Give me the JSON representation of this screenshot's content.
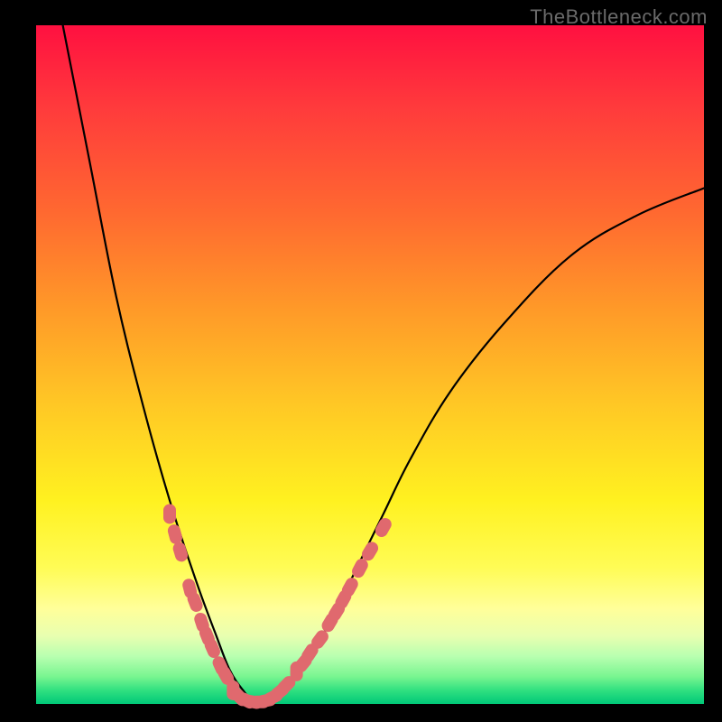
{
  "watermark": "TheBottleneck.com",
  "chart_data": {
    "type": "line",
    "title": "",
    "xlabel": "",
    "ylabel": "",
    "xlim": [
      0,
      100
    ],
    "ylim": [
      0,
      100
    ],
    "grid": false,
    "legend": false,
    "series": [
      {
        "name": "main-curve",
        "color": "#000000",
        "x": [
          4,
          8,
          12,
          16,
          20,
          24,
          27,
          29,
          31,
          33,
          35,
          37,
          40,
          44,
          48,
          52,
          56,
          62,
          70,
          80,
          90,
          100
        ],
        "y": [
          100,
          80,
          60,
          44,
          30,
          18,
          10,
          5,
          2,
          0,
          0,
          2,
          6,
          12,
          20,
          28,
          36,
          46,
          56,
          66,
          72,
          76
        ]
      },
      {
        "name": "overlay-dots-left",
        "color": "#e0696e",
        "x": [
          20.0,
          20.8,
          21.6,
          23.0,
          23.8,
          24.8,
          25.6,
          26.4,
          27.6,
          28.4
        ],
        "y": [
          28.0,
          25.0,
          22.4,
          17.0,
          15.0,
          12.0,
          10.0,
          8.2,
          5.6,
          4.2
        ]
      },
      {
        "name": "overlay-dots-bottom",
        "color": "#e0696e",
        "x": [
          29.5,
          30.5,
          31.5,
          32.5,
          33.5,
          34.5,
          35.5,
          36.5,
          37.5
        ],
        "y": [
          2.0,
          1.0,
          0.5,
          0.3,
          0.3,
          0.5,
          1.0,
          1.8,
          2.8
        ]
      },
      {
        "name": "overlay-dots-right",
        "color": "#e0696e",
        "x": [
          39.0,
          40.0,
          41.0,
          42.5,
          44.0,
          45.0,
          46.0,
          47.0,
          48.5,
          50.0,
          52.0
        ],
        "y": [
          4.8,
          6.0,
          7.5,
          9.5,
          12.0,
          13.6,
          15.4,
          17.2,
          20.0,
          22.5,
          26.0
        ]
      }
    ]
  }
}
